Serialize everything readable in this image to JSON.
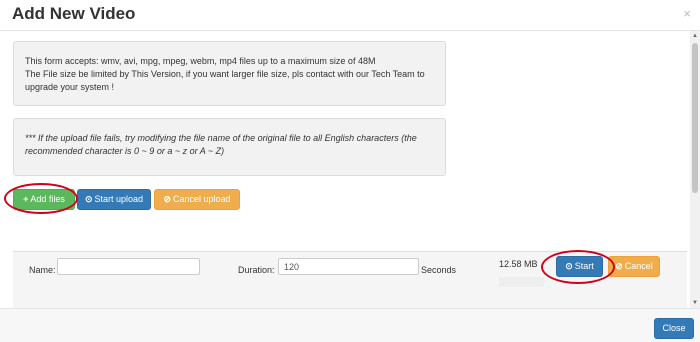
{
  "dialog": {
    "title": "Add New Video",
    "close_glyph": "×"
  },
  "info": {
    "line1": "This form accepts: wmv, avi, mpg, mpeg, webm, mp4 files up to a maximum size of 48M",
    "line2": "The File size be limited by This Version, if you want larger file size, pls contact with our Tech Team to upgrade your system !",
    "note": "***   If the upload file fails, try modifying the file name of the original file to all English characters (the recommended character is 0 ~ 9 or a ~ z or A ~ Z)"
  },
  "toolbar": {
    "add_files": "Add files",
    "add_icon": "+",
    "start_upload": "Start upload",
    "start_upload_icon": "⊙",
    "cancel_upload": "Cancel upload",
    "cancel_icon": "⊘"
  },
  "file_row": {
    "name_label": "Name:",
    "name_value": "",
    "duration_label": "Duration:",
    "duration_value": "120",
    "seconds_label": "Seconds",
    "file_size": "12.58 MB",
    "start_label": "Start",
    "start_icon": "⊙",
    "cancel_label": "Cancel",
    "cancel_icon": "⊘"
  },
  "footer": {
    "close_label": "Close"
  },
  "scrollbar": {
    "up_glyph": "▲",
    "down_glyph": "▼"
  },
  "colors": {
    "primary": "#337ab7",
    "success": "#5cb85c",
    "warning": "#f0ad4e",
    "highlight_ring": "#d0021b"
  }
}
